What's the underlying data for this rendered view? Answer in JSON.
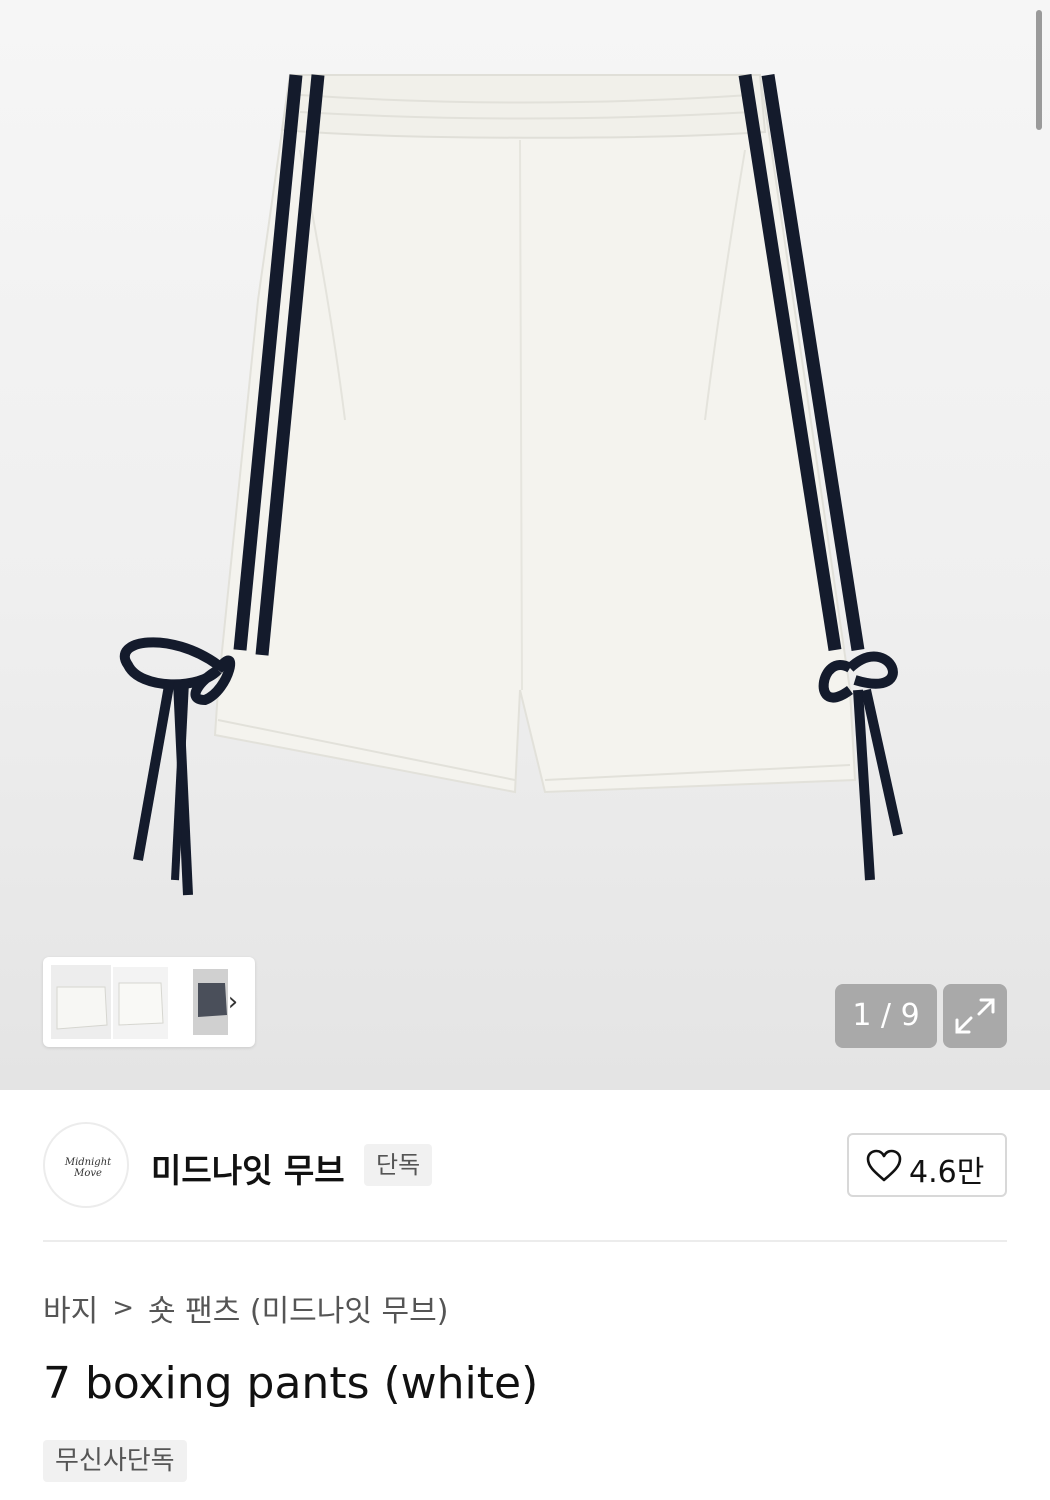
{
  "gallery": {
    "counter": "1 / 9",
    "thumb_arrow": "›",
    "expand_icon": "expand-arrows-icon"
  },
  "brand": {
    "logo_text": "Midnight Move",
    "name": "미드나잇 무브",
    "badge": "단독"
  },
  "like": {
    "icon": "heart-outline-icon",
    "count": "4.6만"
  },
  "breadcrumb": {
    "category": "바지",
    "separator": ">",
    "subcategory": "숏 팬츠 (미드나잇 무브)"
  },
  "product": {
    "title": "7 boxing pants (white)",
    "tag": "무신사단독"
  },
  "colors": {
    "hero_bg": "#efefef",
    "pants_white": "#f4f3ee",
    "stripe_navy": "#141b2c",
    "overlay_gray": "#a9a9a9"
  }
}
